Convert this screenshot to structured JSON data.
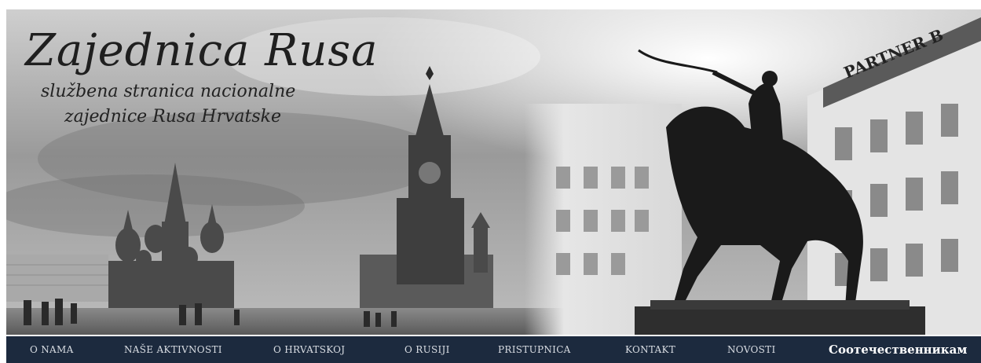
{
  "header": {
    "title": "Zajednica Rusa",
    "subtitle_line1": "službena stranica nacionalne",
    "subtitle_line2": "zajednice Rusa Hrvatske",
    "building_sign": "PARTNER B"
  },
  "nav": {
    "items": [
      {
        "label": "O NAMA"
      },
      {
        "label": "NAŠE AKTIVNOSTI"
      },
      {
        "label": "O HRVATSKOJ"
      },
      {
        "label": "O RUSIJI"
      },
      {
        "label": "PRISTUPNICA"
      },
      {
        "label": "KONTAKT"
      },
      {
        "label": "NOVOSTI"
      },
      {
        "label": "Соотечественникам"
      }
    ]
  },
  "colors": {
    "nav_background": "#1c2a3e",
    "nav_text": "#d9dde3"
  }
}
